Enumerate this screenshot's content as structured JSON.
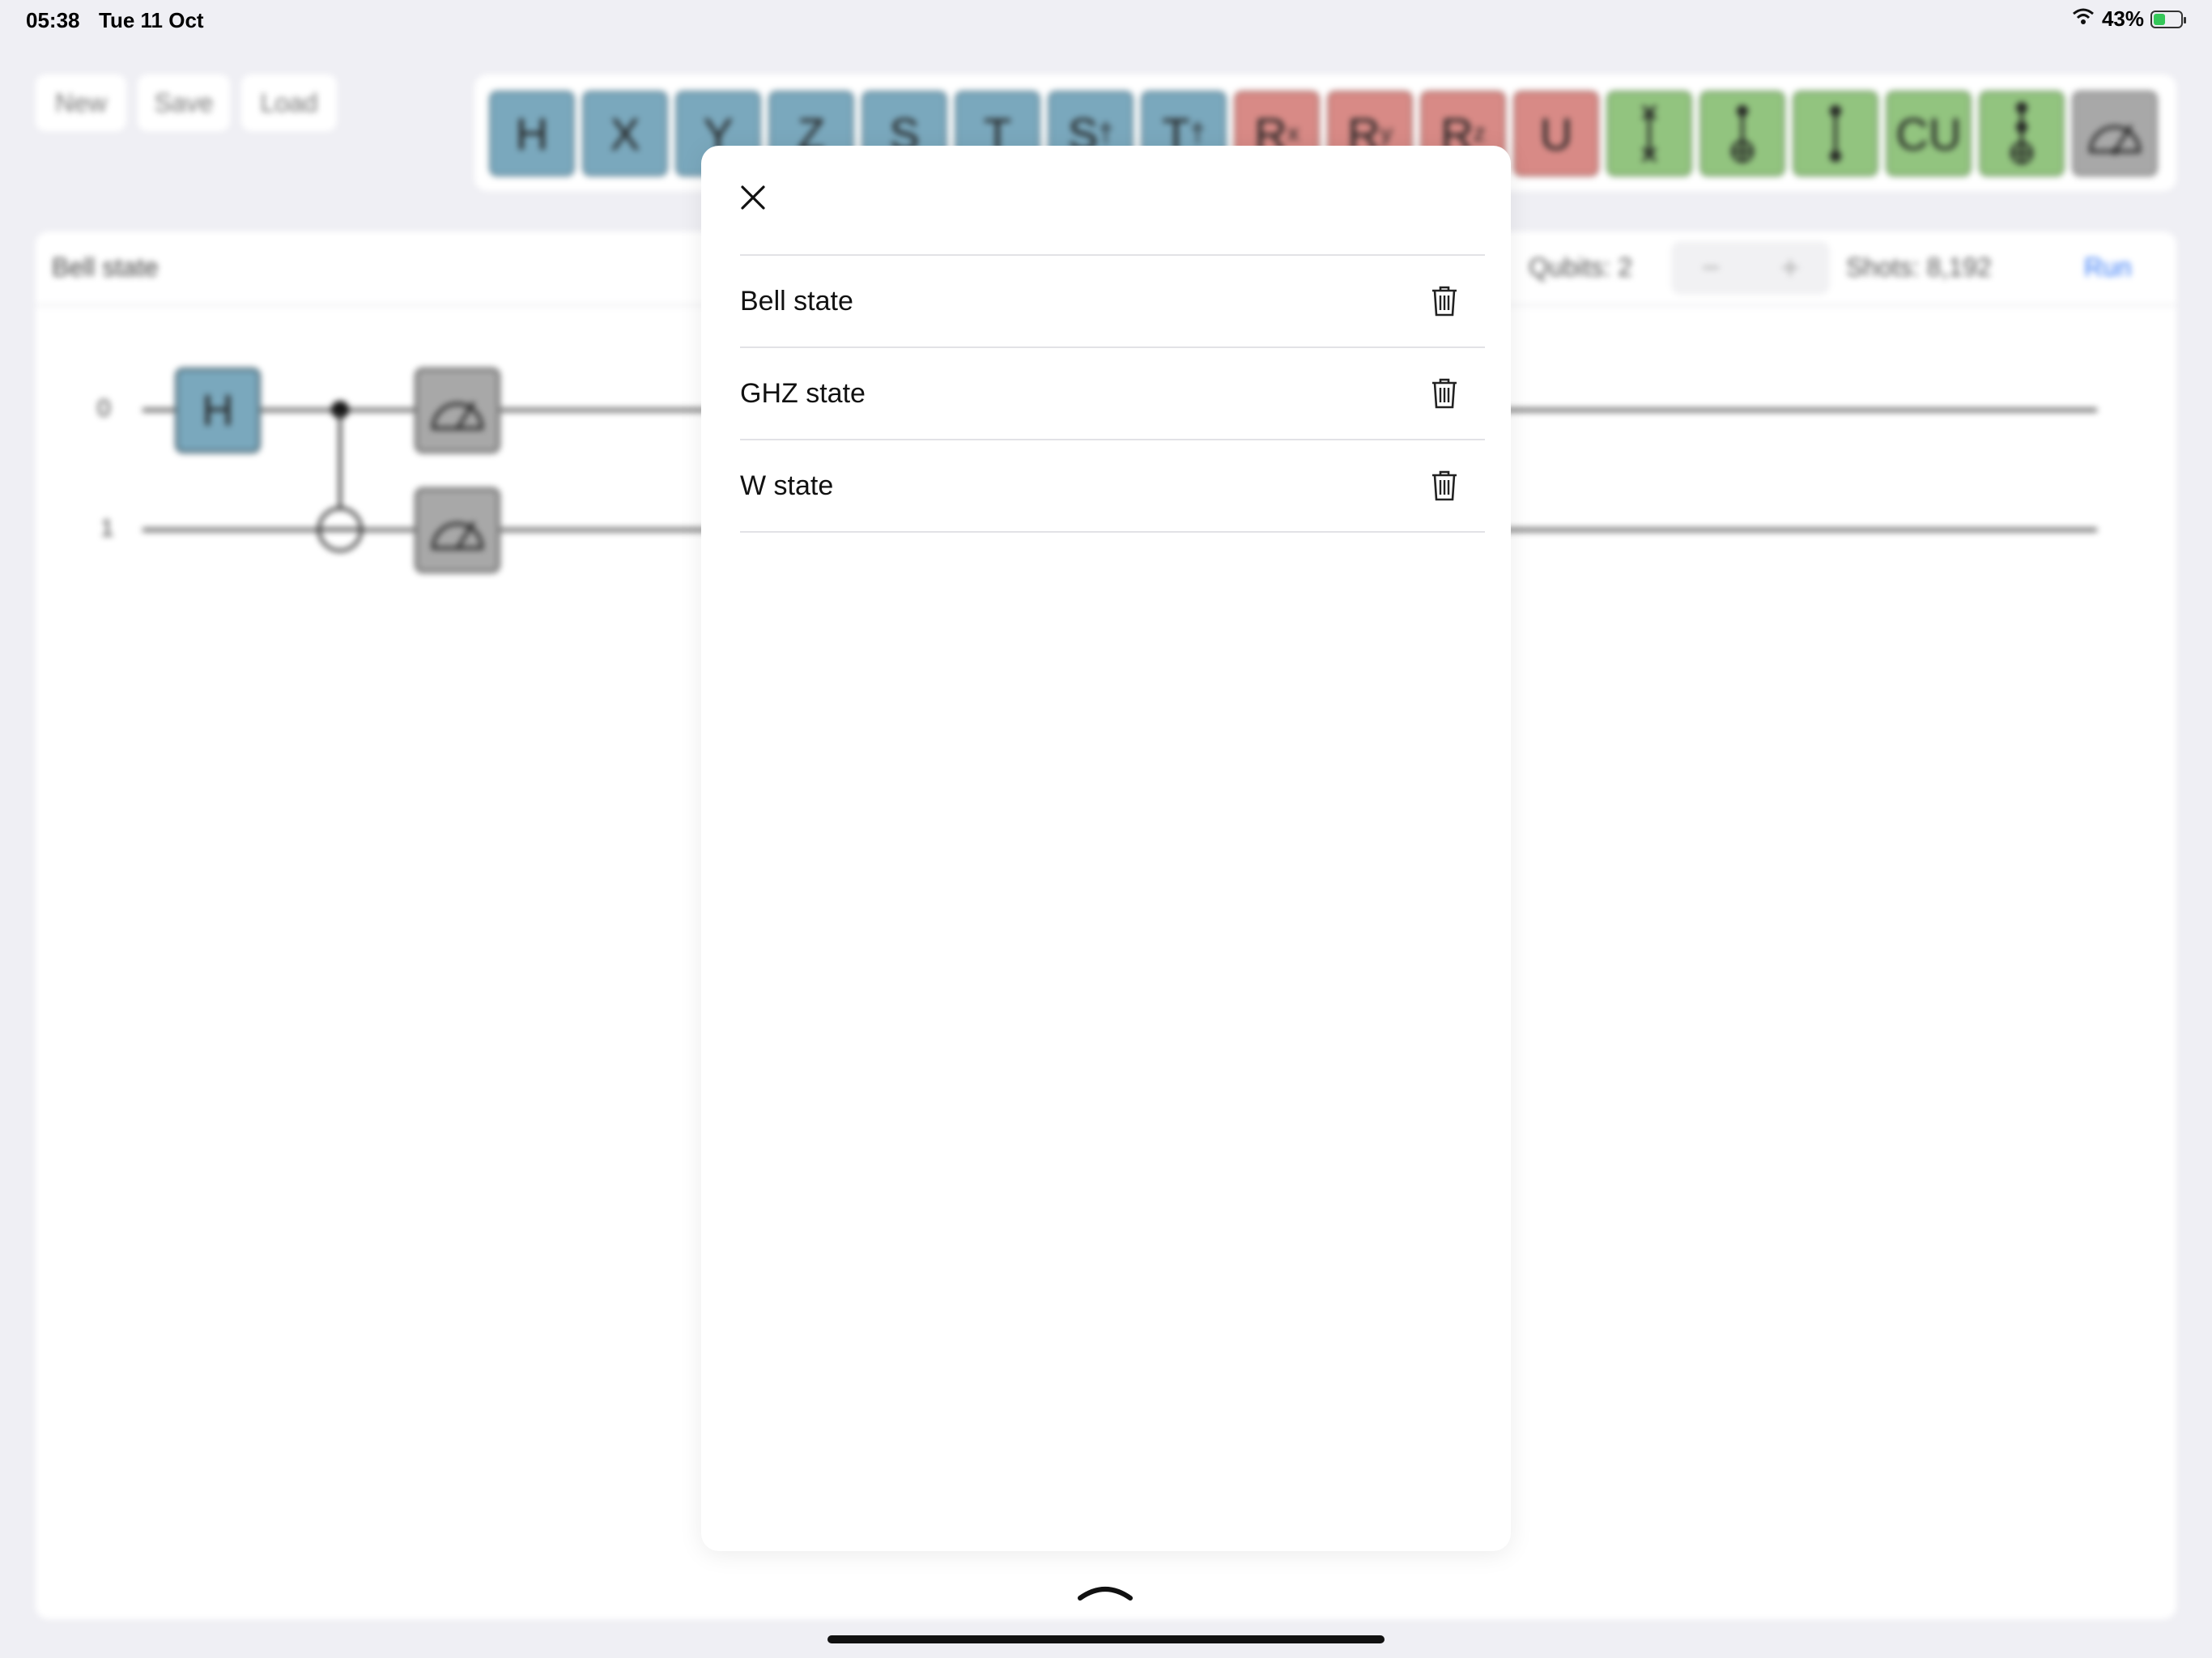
{
  "status_bar": {
    "time": "05:38",
    "date": "Tue 11 Oct",
    "battery": "43%",
    "battery_level": 0.43,
    "icons": [
      "wifi-icon",
      "battery-charging-icon"
    ]
  },
  "toolbar": {
    "new_label": "New",
    "save_label": "Save",
    "load_label": "Load"
  },
  "palette": {
    "gates": [
      {
        "label": "H",
        "color": "blue"
      },
      {
        "label": "X",
        "color": "blue"
      },
      {
        "label": "Y",
        "color": "blue"
      },
      {
        "label": "Z",
        "color": "blue"
      },
      {
        "label": "S",
        "color": "blue"
      },
      {
        "label": "T",
        "color": "blue"
      },
      {
        "label": "S†",
        "color": "blue"
      },
      {
        "label": "T†",
        "color": "blue"
      },
      {
        "label": "Rx",
        "color": "red"
      },
      {
        "label": "Ry",
        "color": "red"
      },
      {
        "label": "Rz",
        "color": "red"
      },
      {
        "label": "U",
        "color": "red"
      },
      {
        "label": "",
        "icon": "swap-icon",
        "color": "green"
      },
      {
        "label": "",
        "icon": "cnot-icon",
        "color": "green"
      },
      {
        "label": "",
        "icon": "cz-icon",
        "color": "green"
      },
      {
        "label": "CU",
        "color": "green"
      },
      {
        "label": "",
        "icon": "toffoli-icon",
        "color": "green"
      },
      {
        "label": "",
        "icon": "measure-icon",
        "color": "gray"
      }
    ],
    "colors": {
      "blue": "#7aa8bd",
      "red": "#d88a86",
      "green": "#92c47f",
      "gray": "#a8a8a8"
    }
  },
  "circuit": {
    "title": "Bell state",
    "qubits_label": "Qubits: 2",
    "stepper_minus": "−",
    "stepper_plus": "+",
    "shots_label": "Shots:",
    "shots_value": "8,192",
    "run_label": "Run",
    "qubit_labels": [
      "0",
      "1"
    ],
    "h_gate_label": "H"
  },
  "load_sheet": {
    "items": [
      {
        "label": "Bell state"
      },
      {
        "label": "GHZ state"
      },
      {
        "label": "W state"
      }
    ]
  },
  "accent_color": "#3478f6"
}
